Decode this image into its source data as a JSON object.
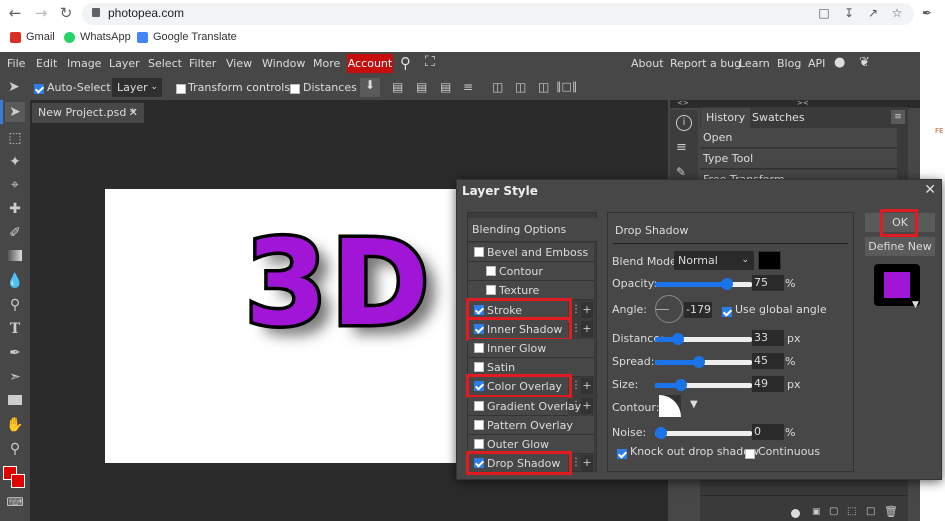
{
  "browser": {
    "url": "photopea.com",
    "bookmarks": [
      {
        "label": "Gmail",
        "color": "#d93025"
      },
      {
        "label": "WhatsApp",
        "color": "#25d366"
      },
      {
        "label": "Google Translate",
        "color": "#4285f4"
      }
    ]
  },
  "menubar": {
    "items": [
      "File",
      "Edit",
      "Image",
      "Layer",
      "Select",
      "Filter",
      "View",
      "Window",
      "More"
    ],
    "account": "Account",
    "right_links": [
      "About",
      "Report a bug",
      "Learn",
      "Blog",
      "API"
    ]
  },
  "tool_options": {
    "auto_select_label": "Auto-Select",
    "auto_select_checked": true,
    "layer_select": "Layer",
    "transform_controls_label": "Transform controls",
    "distances_label": "Distances"
  },
  "document": {
    "tab_label": "New Project.psd *",
    "canvas_text": "3D",
    "text_color": "#a015d6"
  },
  "history_panel": {
    "tabs": [
      "History",
      "Swatches"
    ],
    "items": [
      "Open",
      "Type Tool",
      "Free Transform"
    ]
  },
  "layer_style": {
    "title": "Layer Style",
    "blending_options": "Blending Options",
    "styles": [
      {
        "label": "Bevel and Emboss",
        "checked": false,
        "indent": false,
        "highlight": false,
        "plus": false
      },
      {
        "label": "Contour",
        "checked": false,
        "indent": true,
        "highlight": false,
        "plus": false
      },
      {
        "label": "Texture",
        "checked": false,
        "indent": true,
        "highlight": false,
        "plus": false
      },
      {
        "label": "Stroke",
        "checked": true,
        "indent": false,
        "highlight": true,
        "plus": true
      },
      {
        "label": "Inner Shadow",
        "checked": true,
        "indent": false,
        "highlight": true,
        "plus": true
      },
      {
        "label": "Inner Glow",
        "checked": false,
        "indent": false,
        "highlight": false,
        "plus": false
      },
      {
        "label": "Satin",
        "checked": false,
        "indent": false,
        "highlight": false,
        "plus": false
      },
      {
        "label": "Color Overlay",
        "checked": true,
        "indent": false,
        "highlight": true,
        "plus": true
      },
      {
        "label": "Gradient Overlay",
        "checked": false,
        "indent": false,
        "highlight": false,
        "plus": true
      },
      {
        "label": "Pattern Overlay",
        "checked": false,
        "indent": false,
        "highlight": false,
        "plus": false
      },
      {
        "label": "Outer Glow",
        "checked": false,
        "indent": false,
        "highlight": false,
        "plus": false
      },
      {
        "label": "Drop Shadow",
        "checked": true,
        "indent": false,
        "highlight": true,
        "plus": true
      }
    ],
    "drop_shadow": {
      "section_title": "Drop Shadow",
      "blend_mode_label": "Blend Mode:",
      "blend_mode": "Normal",
      "shadow_color": "#000000",
      "opacity_label": "Opacity:",
      "opacity": "75",
      "opacity_unit": "%",
      "angle_label": "Angle:",
      "angle": "-179",
      "use_global_angle_label": "Use global angle",
      "use_global_angle": true,
      "distance_label": "Distance:",
      "distance": "33",
      "distance_unit": "px",
      "spread_label": "Spread:",
      "spread": "45",
      "spread_unit": "%",
      "size_label": "Size:",
      "size": "49",
      "size_unit": "px",
      "contour_label": "Contour:",
      "noise_label": "Noise:",
      "noise": "0",
      "noise_unit": "%",
      "knockout_label": "Knock out drop shadow",
      "knockout": true,
      "continuous_label": "Continuous",
      "continuous": false
    },
    "ok_label": "OK",
    "define_new_label": "Define New",
    "preview_color": "#a015d6",
    "accent_highlight": "#e21b23"
  },
  "colors": {
    "foreground": "#e00000",
    "background": "#e00000",
    "slider": "#1a73e8"
  }
}
